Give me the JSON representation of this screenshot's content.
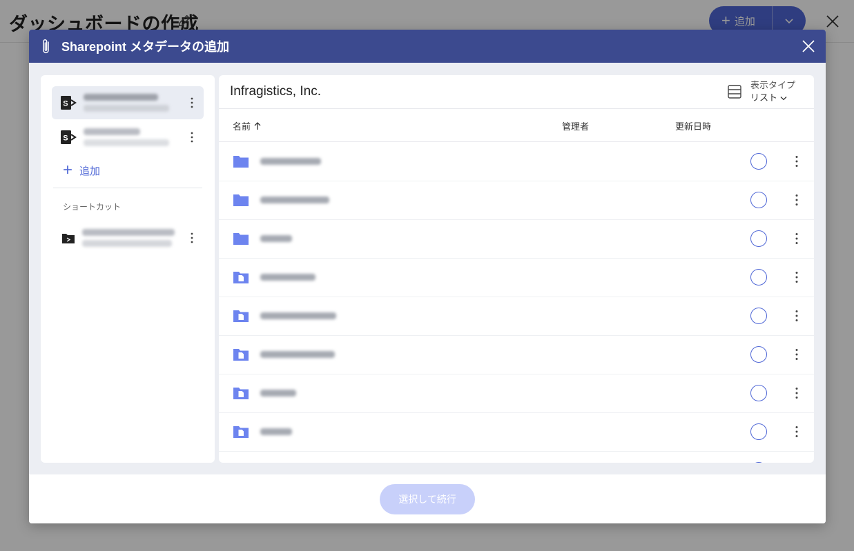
{
  "background": {
    "title": "ダッシュボードの作成",
    "add_button_label": "追加",
    "icons": {
      "edit": "pencil-icon",
      "close": "close-icon",
      "dropdown": "chevron-down-icon"
    }
  },
  "dialog": {
    "title": "Sharepoint メタデータの追加",
    "icons": {
      "title": "paperclip-icon",
      "close": "close-icon"
    },
    "accent_color": "#4f67d6",
    "header_color": "#3c4a8f"
  },
  "sidebar": {
    "add_label": "追加",
    "shortcuts_label": "ショートカット",
    "sources": [
      {
        "icon": "sharepoint-icon",
        "active": true
      },
      {
        "icon": "sharepoint-icon",
        "active": false
      }
    ],
    "shortcuts": [
      {
        "icon": "sharepoint-shortcut-icon"
      }
    ]
  },
  "main": {
    "title": "Infragistics, Inc.",
    "view_type": {
      "label": "表示タイプ",
      "value": "リスト",
      "icon": "list-view-icon"
    },
    "columns": {
      "name": "名前",
      "owner": "管理者",
      "modified": "更新日時"
    },
    "sort_icon": "arrow-up-icon",
    "rows": [
      {
        "type": "folder",
        "icon": "folder-icon"
      },
      {
        "type": "folder",
        "icon": "folder-icon"
      },
      {
        "type": "folder",
        "icon": "folder-icon"
      },
      {
        "type": "library",
        "icon": "document-library-icon"
      },
      {
        "type": "library",
        "icon": "document-library-icon"
      },
      {
        "type": "library",
        "icon": "document-library-icon"
      },
      {
        "type": "library",
        "icon": "document-library-icon"
      },
      {
        "type": "library",
        "icon": "document-library-icon"
      }
    ]
  },
  "footer": {
    "continue_label": "選択して続行"
  }
}
